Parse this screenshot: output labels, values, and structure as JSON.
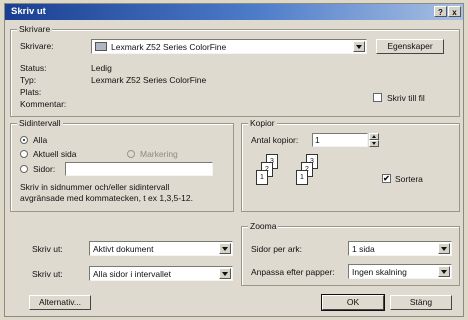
{
  "window": {
    "title": "Skriv ut",
    "help_label": "?",
    "close_label": "x"
  },
  "printer": {
    "group_label": "Skrivare",
    "name_label": "Skrivare:",
    "name_value": "Lexmark Z52 Series ColorFine",
    "properties_label": "Egenskaper",
    "status_label": "Status:",
    "status_value": "Ledig",
    "type_label": "Typ:",
    "type_value": "Lexmark Z52 Series ColorFine",
    "location_label": "Plats:",
    "comment_label": "Kommentar:",
    "print_to_file_label": "Skriv till fil",
    "print_to_file_checked": false
  },
  "range": {
    "group_label": "Sidintervall",
    "all_label": "Alla",
    "current_label": "Aktuell sida",
    "selection_label": "Markering",
    "pages_label": "Sidor:",
    "pages_value": "",
    "help_text_line1": "Skriv in sidnummer och/eller sidintervall",
    "help_text_line2": "avgränsade med kommatecken, t ex 1,3,5-12.",
    "selected": "all"
  },
  "copies": {
    "group_label": "Kopior",
    "count_label": "Antal kopior:",
    "count_value": "1",
    "collate_label": "Sortera",
    "collate_checked": true,
    "page_numbers": [
      "1",
      "2",
      "3"
    ]
  },
  "print_what": {
    "label": "Skriv ut:",
    "value": "Aktivt dokument"
  },
  "print_pages": {
    "label": "Skriv ut:",
    "value": "Alla sidor i intervallet"
  },
  "zoom": {
    "group_label": "Zooma",
    "per_sheet_label": "Sidor per ark:",
    "per_sheet_value": "1 sida",
    "scale_label": "Anpassa efter papper:",
    "scale_value": "Ingen skalning"
  },
  "buttons": {
    "options": "Alternativ...",
    "ok": "OK",
    "close": "Stäng"
  },
  "check_mark": "✔"
}
